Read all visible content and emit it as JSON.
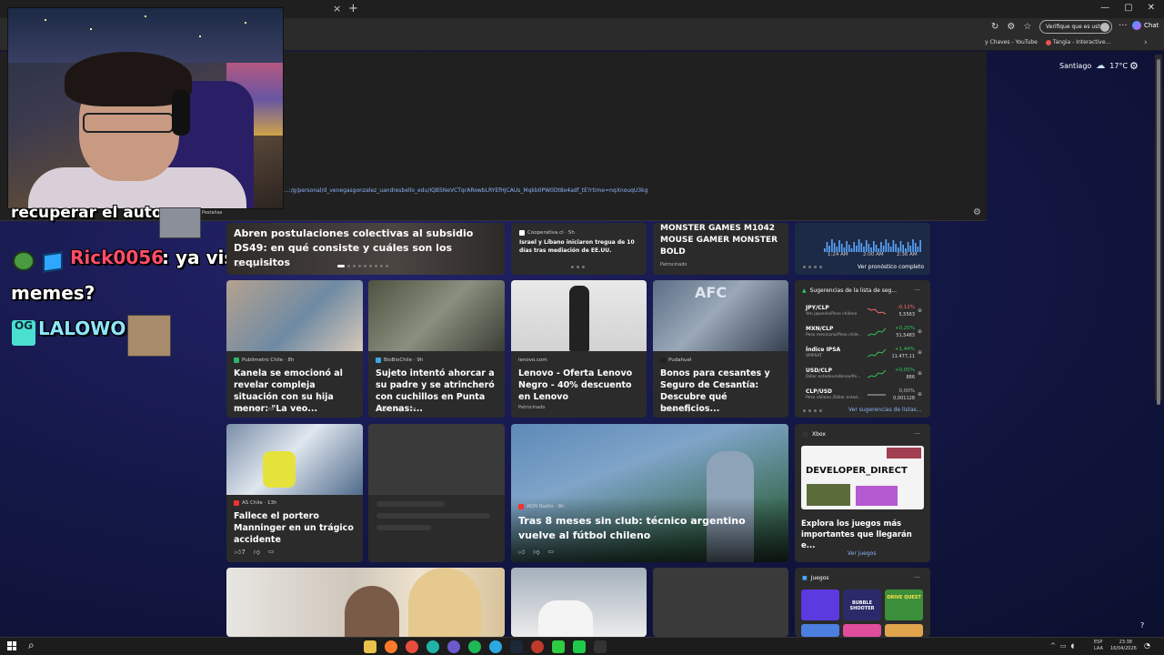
{
  "browser": {
    "tab_close": "×",
    "tab_new": "+",
    "window_controls": [
      "—",
      "▢",
      "✕"
    ],
    "verify_pill": "Verifique que es usted",
    "more": "···",
    "chat_label": "Chat",
    "bookmarks": [
      "y Chaves - YouTube",
      "Tangia - Interactive..."
    ],
    "bookmarks_chevron": "›",
    "url_line": "...:/g/personal/d_venegasgonzalez_uandresbello_edu/IQB5NeVCTqrARowbLRYEfHJCAUs_Mqkb0PW0Dt8o4adf_tE?rtime=nqXnouqU3kg"
  },
  "weather": {
    "city": "Santiago",
    "icon": "cloud-icon",
    "temp": "17°C"
  },
  "chat": {
    "prev_line": "recuperar el auto",
    "emote_label": "Pestañas",
    "user1": "Rick0056",
    "msg1": ": ya viste",
    "msg1b": "memes?",
    "user2": "LALOWO",
    "user2_sep": ":",
    "og_badge": "OG"
  },
  "feed": {
    "hero": {
      "title": "Abren postulaciones colectivas al subsidio DS49: en qué consiste y cuáles son los requisitos"
    },
    "coop": {
      "source": "Cooperativa.cl · 5h",
      "title": "Israel y Líbano iniciaron tregua de 10 días tras mediación de EE.UU."
    },
    "ad_monster": {
      "title": "MONSTER GAMES M1042 MOUSE GAMER MONSTER BOLD",
      "sponsored": "Patrocinado"
    },
    "weather_widget": {
      "times": [
        "1:24 AM",
        "2:00 AM",
        "2:36 AM"
      ],
      "link": "Ver pronóstico completo"
    },
    "row2": [
      {
        "source": "Publimetro Chile · 8h",
        "title": "Kanela se emocionó al revelar compleja situación con su hija menor: \"La veo...",
        "likes": "4"
      },
      {
        "source": "BioBioChile · 9h",
        "title": "Sujeto intentó ahorcar a su padre y se atrincheró con cuchillos en Punta Arenas:...",
        "likes": "6"
      },
      {
        "source": "lenovo.com",
        "title": "Lenovo - Oferta Lenovo Negro - 40% descuento en Lenovo",
        "sponsored": "Patrocinado"
      },
      {
        "source": "Pudahuel",
        "title": "Bonos para cesantes y Seguro de Cesantía: Descubre qué beneficios...",
        "likes": "14"
      }
    ],
    "watchlist": {
      "title": "Sugerencias de la lista de seg...",
      "rows": [
        {
          "sym": "JPY/CLP",
          "sub": "Yen japonés/Peso chileno",
          "chg": "-0,12%",
          "px": "5,5563",
          "up": false
        },
        {
          "sym": "MXN/CLP",
          "sub": "Peso mexicano/Peso chile...",
          "chg": "+0,20%",
          "px": "51,5483",
          "up": true
        },
        {
          "sym": "Índice IPSA",
          "sub": "SPIPSAT",
          "chg": "+1,44%",
          "px": "11.477,11",
          "up": true
        },
        {
          "sym": "USD/CLP",
          "sub": "Dólar estadounidense/Pe...",
          "chg": "+0,05%",
          "px": "886",
          "up": true
        },
        {
          "sym": "CLP/USD",
          "sub": "Peso chileno /Dólar estad...",
          "chg": "0,00%",
          "px": "0,001128",
          "up": null
        }
      ],
      "link": "Ver sugerencias de listas..."
    },
    "row3": {
      "portero": {
        "source": "AS Chile · 13h",
        "title": "Fallece el portero Manninger en un trágico accidente",
        "likes": "7"
      },
      "tecnico": {
        "source": "ADN Radio · 9h",
        "title": "Tras 8 meses sin club: técnico argentino vuelve al fútbol chileno"
      },
      "xbox": {
        "head": "Xbox",
        "banner": "DEVELOPER_DIRECT",
        "title": "Explora los juegos más importantes que llegarán e...",
        "link": "Ver juegos"
      }
    },
    "games": {
      "head": "Juegos",
      "tiles": [
        "BUBBLE SHOOTER",
        "DRIVE QUEST"
      ]
    }
  },
  "taskbar": {
    "lang": [
      "ESP",
      "LAA"
    ],
    "time": "23:38",
    "date": "16/04/2026",
    "tray_chevron": "^"
  },
  "colors": {
    "up": "#31c45a",
    "down": "#ff6b6b",
    "link": "#8ab4f8"
  }
}
